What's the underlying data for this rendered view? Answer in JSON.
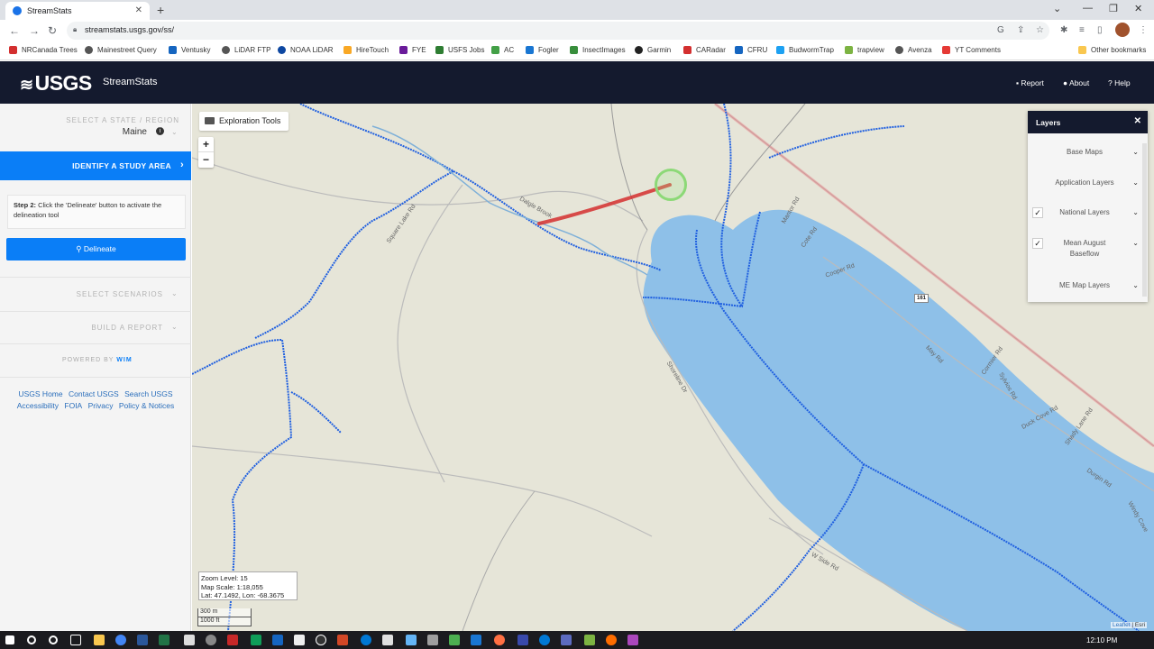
{
  "browser": {
    "tab_title": "StreamStats",
    "url": "streamstats.usgs.gov/ss/",
    "bookmarks": [
      "NRCanada Trees",
      "Mainestreet Query",
      "Ventusky",
      "LiDAR FTP",
      "NOAA LiDAR",
      "HireTouch",
      "FYE",
      "USFS Jobs",
      "AC",
      "Fogler",
      "InsectImages",
      "Garmin",
      "CARadar",
      "CFRU",
      "BudwormTrap",
      "trapview",
      "Avenza",
      "YT Comments"
    ],
    "other_bookmarks": "Other bookmarks"
  },
  "header": {
    "logo": "USGS",
    "app_name": "StreamStats",
    "report": "Report",
    "about": "About",
    "help": "Help"
  },
  "sidebar": {
    "select_state_label": "SELECT A STATE / REGION",
    "state_value": "Maine",
    "identify_label": "IDENTIFY A STUDY AREA",
    "step_bold": "Step 2:",
    "step_text": " Click the 'Delineate' button to activate the delineation tool",
    "delineate": "Delineate",
    "select_scenarios": "SELECT SCENARIOS",
    "build_report": "BUILD A REPORT",
    "powered_by": "POWERED BY",
    "powered_brand": "WIM",
    "links_row1": [
      "USGS Home",
      "Contact USGS",
      "Search USGS"
    ],
    "links_row2": [
      "Accessibility",
      "FOIA",
      "Privacy",
      "Policy & Notices"
    ]
  },
  "map": {
    "exploration_tools": "Exploration Tools",
    "zoom_in": "+",
    "zoom_out": "−",
    "zoom_level": "Zoom Level: 15",
    "map_scale": "Map Scale: 1:18,055",
    "lat_lon": "Lat: 47.1492, Lon: -68.3675",
    "scale_m": "300 m",
    "scale_ft": "1000 ft",
    "attribution_leaflet": "Leaflet",
    "attribution_esri": "Esri",
    "road_labels": [
      "Dalgle Brook",
      "Square Lake Rd",
      "Shoreline Dr",
      "Cooper Rd",
      "Cote Rd",
      "Mantor Rd",
      "May Rd",
      "Cormier Rd",
      "Sylvios Rd",
      "Duck Cove Rd",
      "Shady Lane Rd",
      "Durgin Rd",
      "Windy Cove",
      "W Side Rd"
    ],
    "route_shield": "161"
  },
  "layers": {
    "title": "Layers",
    "items": [
      {
        "label": "Base Maps",
        "checked": false
      },
      {
        "label": "Application Layers",
        "checked": false
      },
      {
        "label": "National Layers",
        "checked": true
      },
      {
        "label": "Mean August Baseflow",
        "checked": true
      },
      {
        "label": "ME Map Layers",
        "checked": false
      }
    ]
  },
  "taskbar": {
    "time": "12:10 PM"
  }
}
